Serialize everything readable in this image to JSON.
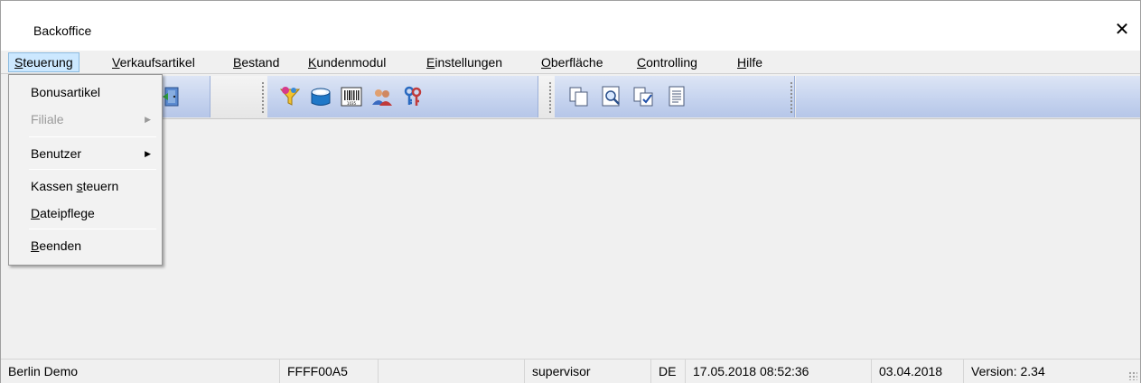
{
  "window": {
    "title": "Backoffice",
    "close_glyph": "✕"
  },
  "menubar": {
    "items": [
      {
        "pre": "",
        "u": "S",
        "post": "teuerung"
      },
      {
        "pre": "",
        "u": "V",
        "post": "erkaufsartikel"
      },
      {
        "pre": "",
        "u": "B",
        "post": "estand"
      },
      {
        "pre": "",
        "u": "K",
        "post": "undenmodul"
      },
      {
        "pre": "",
        "u": "E",
        "post": "instellungen"
      },
      {
        "pre": "",
        "u": "O",
        "post": "berfläche"
      },
      {
        "pre": "",
        "u": "C",
        "post": "ontrolling"
      },
      {
        "pre": "",
        "u": "H",
        "post": "ilfe"
      }
    ]
  },
  "dropdown": {
    "items": [
      {
        "label": "Bonusartikel"
      },
      {
        "label": "Filiale",
        "arrow": "▶"
      },
      {
        "label": "Benutzer",
        "arrow": "▶"
      },
      {
        "pre": "Kassen ",
        "u": "s",
        "post": "teuern"
      },
      {
        "pre": "",
        "u": "D",
        "post": "ateipflege"
      },
      {
        "pre": "",
        "u": "B",
        "post": "eenden"
      }
    ]
  },
  "toolbar": {
    "icons": [
      "exit-door-icon",
      "filter-funnel-icon",
      "database-icon",
      "barcode-icon",
      "users-icon",
      "keys-icon",
      "new-document-icon",
      "preview-icon",
      "checked-document-icon",
      "text-document-icon"
    ],
    "barcode_text": "1035"
  },
  "statusbar": {
    "location": "Berlin Demo",
    "code": "FFFF00A5",
    "user": "supervisor",
    "language": "DE",
    "datetime": "17.05.2018 08:52:36",
    "date": "03.04.2018",
    "version": "Version: 2.34"
  },
  "colors": {
    "menu_active_bg": "#cce8ff",
    "toolbar_band": "#c4d2ee"
  }
}
